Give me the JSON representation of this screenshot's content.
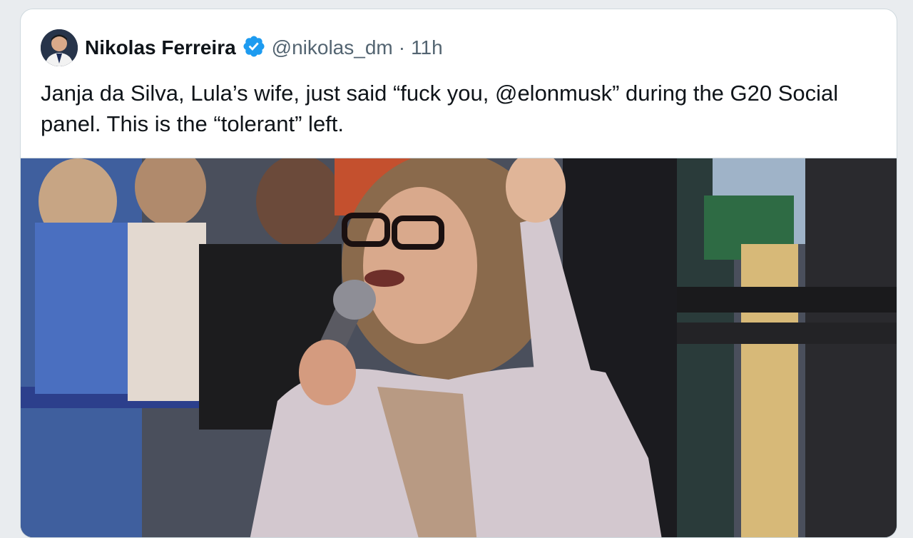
{
  "tweet": {
    "author_name": "Nikolas Ferreira",
    "handle": "@nikolas_dm",
    "separator": "·",
    "time": "11h",
    "verified": true,
    "text": "Janja da Silva, Lula’s wife, just said “fuck you, @elonmusk” during the G20 Social panel. This is the “tolerant” left."
  },
  "media": {
    "type": "video-thumbnail",
    "description_visible_text": ""
  },
  "colors": {
    "accent": "#1d9bf0",
    "text": "#0f1419",
    "muted": "#536471",
    "border": "#cfd9de"
  },
  "icons": {
    "verified": "verified-badge-icon",
    "avatar": "user-avatar"
  }
}
